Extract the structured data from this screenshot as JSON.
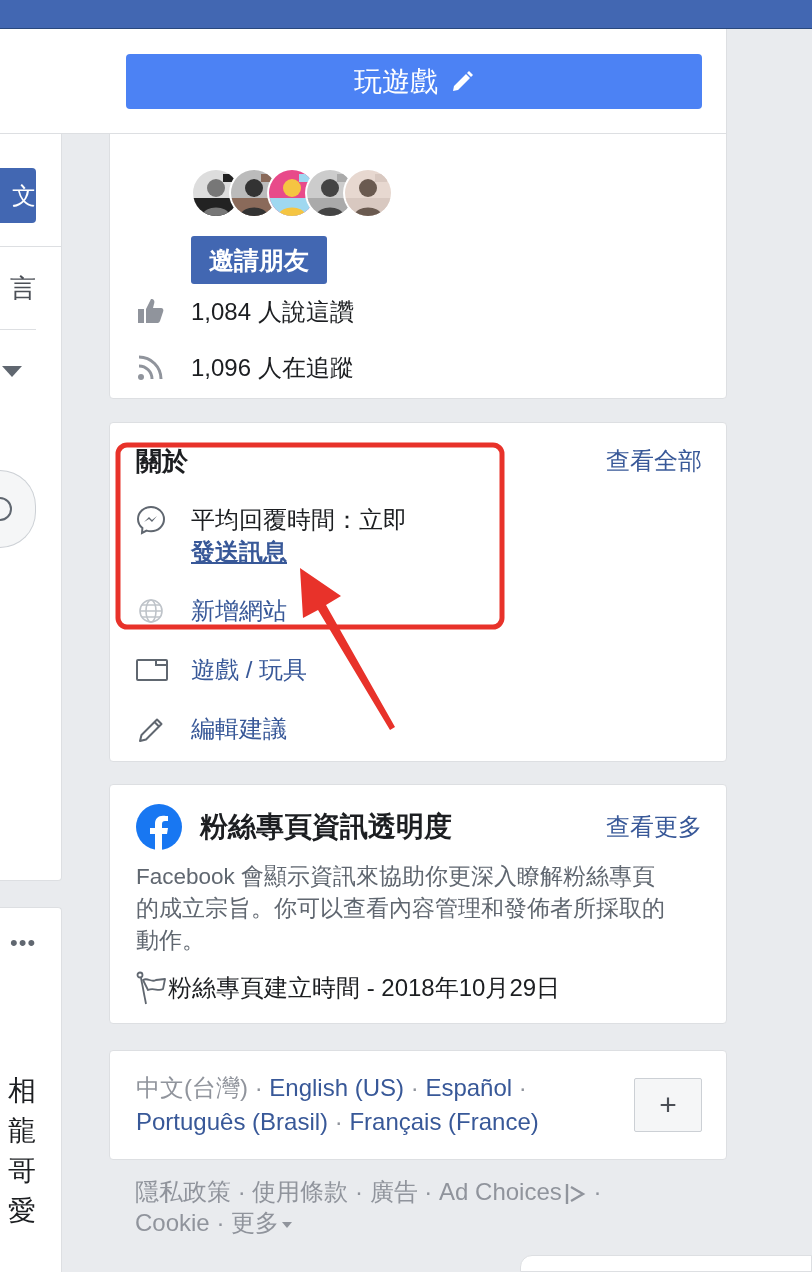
{
  "left_column": {
    "button": "文",
    "comment_tab": "言",
    "more": "•••",
    "snippet_lines": [
      "相",
      "龍",
      "哥",
      "愛"
    ]
  },
  "header_button": {
    "label": "玩遊戲"
  },
  "community": {
    "invite_button": "邀請朋友",
    "stats": [
      {
        "kind": "likes",
        "text": "1,084 人說這讚"
      },
      {
        "kind": "follows",
        "text": "1,096 人在追蹤"
      }
    ]
  },
  "about": {
    "title": "關於",
    "see_all": "查看全部",
    "items": [
      {
        "kind": "messenger",
        "text": "平均回覆時間：立即",
        "link": "發送訊息"
      },
      {
        "kind": "website",
        "text": "新增網站"
      },
      {
        "kind": "category",
        "text": "遊戲 / 玩具"
      },
      {
        "kind": "edit",
        "text": "編輯建議"
      }
    ]
  },
  "transparency": {
    "title": "粉絲專頁資訊透明度",
    "see_more": "查看更多",
    "description": "Facebook 會顯示資訊來協助你更深入瞭解粉絲專頁的成立宗旨。你可以查看內容管理和發佈者所採取的動作。",
    "created": "粉絲專頁建立時間 - 2018年10月29日"
  },
  "languages": {
    "separator": "·",
    "add_button": "+",
    "items": [
      {
        "text": "中文(台灣)",
        "selected": true
      },
      {
        "text": "English (US)",
        "selected": false
      },
      {
        "text": "Español",
        "selected": false
      },
      {
        "text": "Português (Brasil)",
        "selected": false
      },
      {
        "text": "Français (France)",
        "selected": false
      }
    ]
  },
  "footer": {
    "separator": "·",
    "links": [
      {
        "kind": "plain",
        "text": "隱私政策"
      },
      {
        "kind": "plain",
        "text": "使用條款"
      },
      {
        "kind": "plain",
        "text": "廣告"
      },
      {
        "kind": "adchoices",
        "text": "Ad Choices"
      },
      {
        "kind": "plain",
        "text": "Cookie"
      },
      {
        "kind": "menu",
        "text": "更多"
      }
    ]
  },
  "annotation": {
    "highlight_box": true,
    "arrow": true
  }
}
